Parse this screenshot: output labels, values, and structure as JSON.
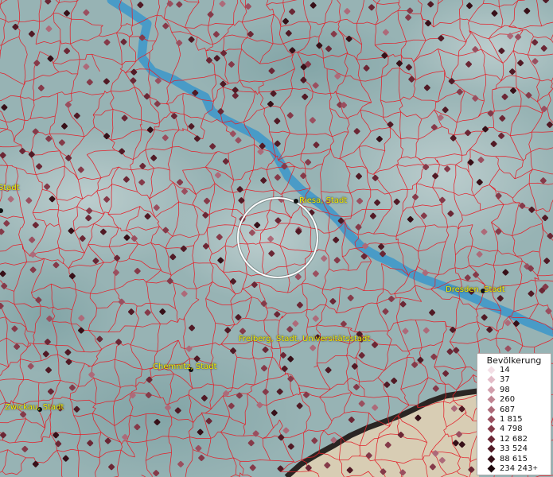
{
  "labels": {
    "riesa": "Riesa, Stadt",
    "dresden": "Dresden, Stadt",
    "freiberg": "Freiberg, Stadt, Universitätsstadt",
    "chemnitz": "Chemnitz, Stadt",
    "zwickau": "Zwickau, Stadt",
    "left_edge": "Stadt"
  },
  "legend": {
    "title": "Bevölkerung",
    "plus": "+",
    "entries": [
      {
        "value": "14",
        "color": "#f3dfe6"
      },
      {
        "value": "37",
        "color": "#e3bcc8"
      },
      {
        "value": "98",
        "color": "#d29fad"
      },
      {
        "value": "260",
        "color": "#c08492"
      },
      {
        "value": "687",
        "color": "#ad6a79"
      },
      {
        "value": "1 815",
        "color": "#9a4f5f"
      },
      {
        "value": "4 798",
        "color": "#853a49"
      },
      {
        "value": "12 682",
        "color": "#6b2735"
      },
      {
        "value": "33 524",
        "color": "#511a25"
      },
      {
        "value": "88 615",
        "color": "#371018"
      },
      {
        "value": "234 243",
        "color": "#1c070b"
      }
    ]
  },
  "colors": {
    "terrain": "#97b3b4",
    "boundary": "#e3202a",
    "river": "#3f97c9",
    "label": "#f5f000",
    "border_band": "#2a2523"
  }
}
